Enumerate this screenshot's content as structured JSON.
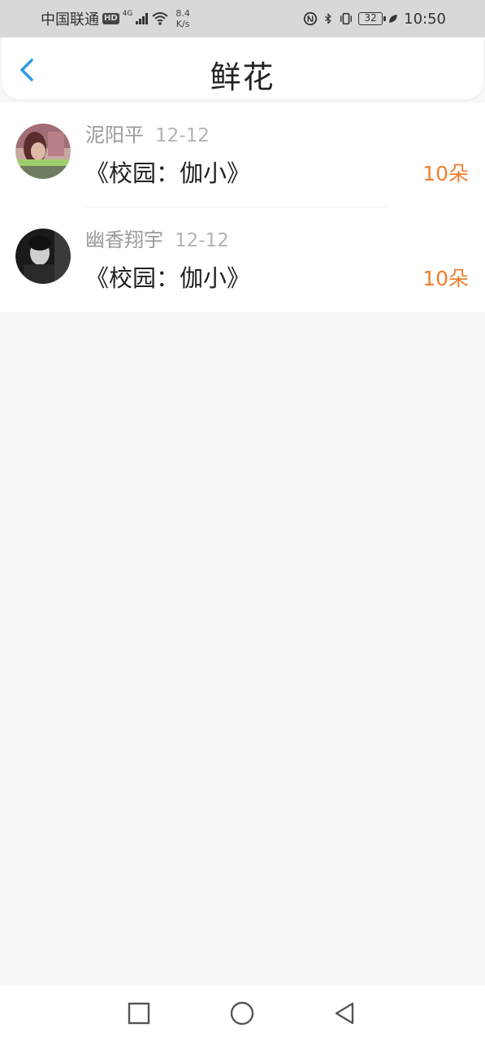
{
  "status_bar": {
    "carrier": "中国联通",
    "hd_badge": "HD",
    "network_type": "4G",
    "speed_value": "8.4",
    "speed_unit": "K/s",
    "battery_level": "32",
    "time": "10:50",
    "icons": [
      "signal-icon",
      "wifi-icon",
      "nfc-icon",
      "bluetooth-icon",
      "vibrate-icon",
      "battery-icon",
      "leaf-icon"
    ]
  },
  "header": {
    "title": "鲜花",
    "back_icon": "chevron-left-icon",
    "accent_color": "#2f9be6"
  },
  "list": {
    "items": [
      {
        "name": "泥阳平",
        "date": "12-12",
        "book": "《校园：伽小》",
        "count": "10朵",
        "avatar": "avatar-girl-photo"
      },
      {
        "name": "幽香翔宇",
        "date": "12-12",
        "book": "《校园：伽小》",
        "count": "10朵",
        "avatar": "avatar-man-bw-photo"
      }
    ],
    "count_color": "#ee7f2d"
  },
  "navbar": {
    "buttons": [
      "square-icon",
      "circle-icon",
      "triangle-back-icon"
    ]
  }
}
